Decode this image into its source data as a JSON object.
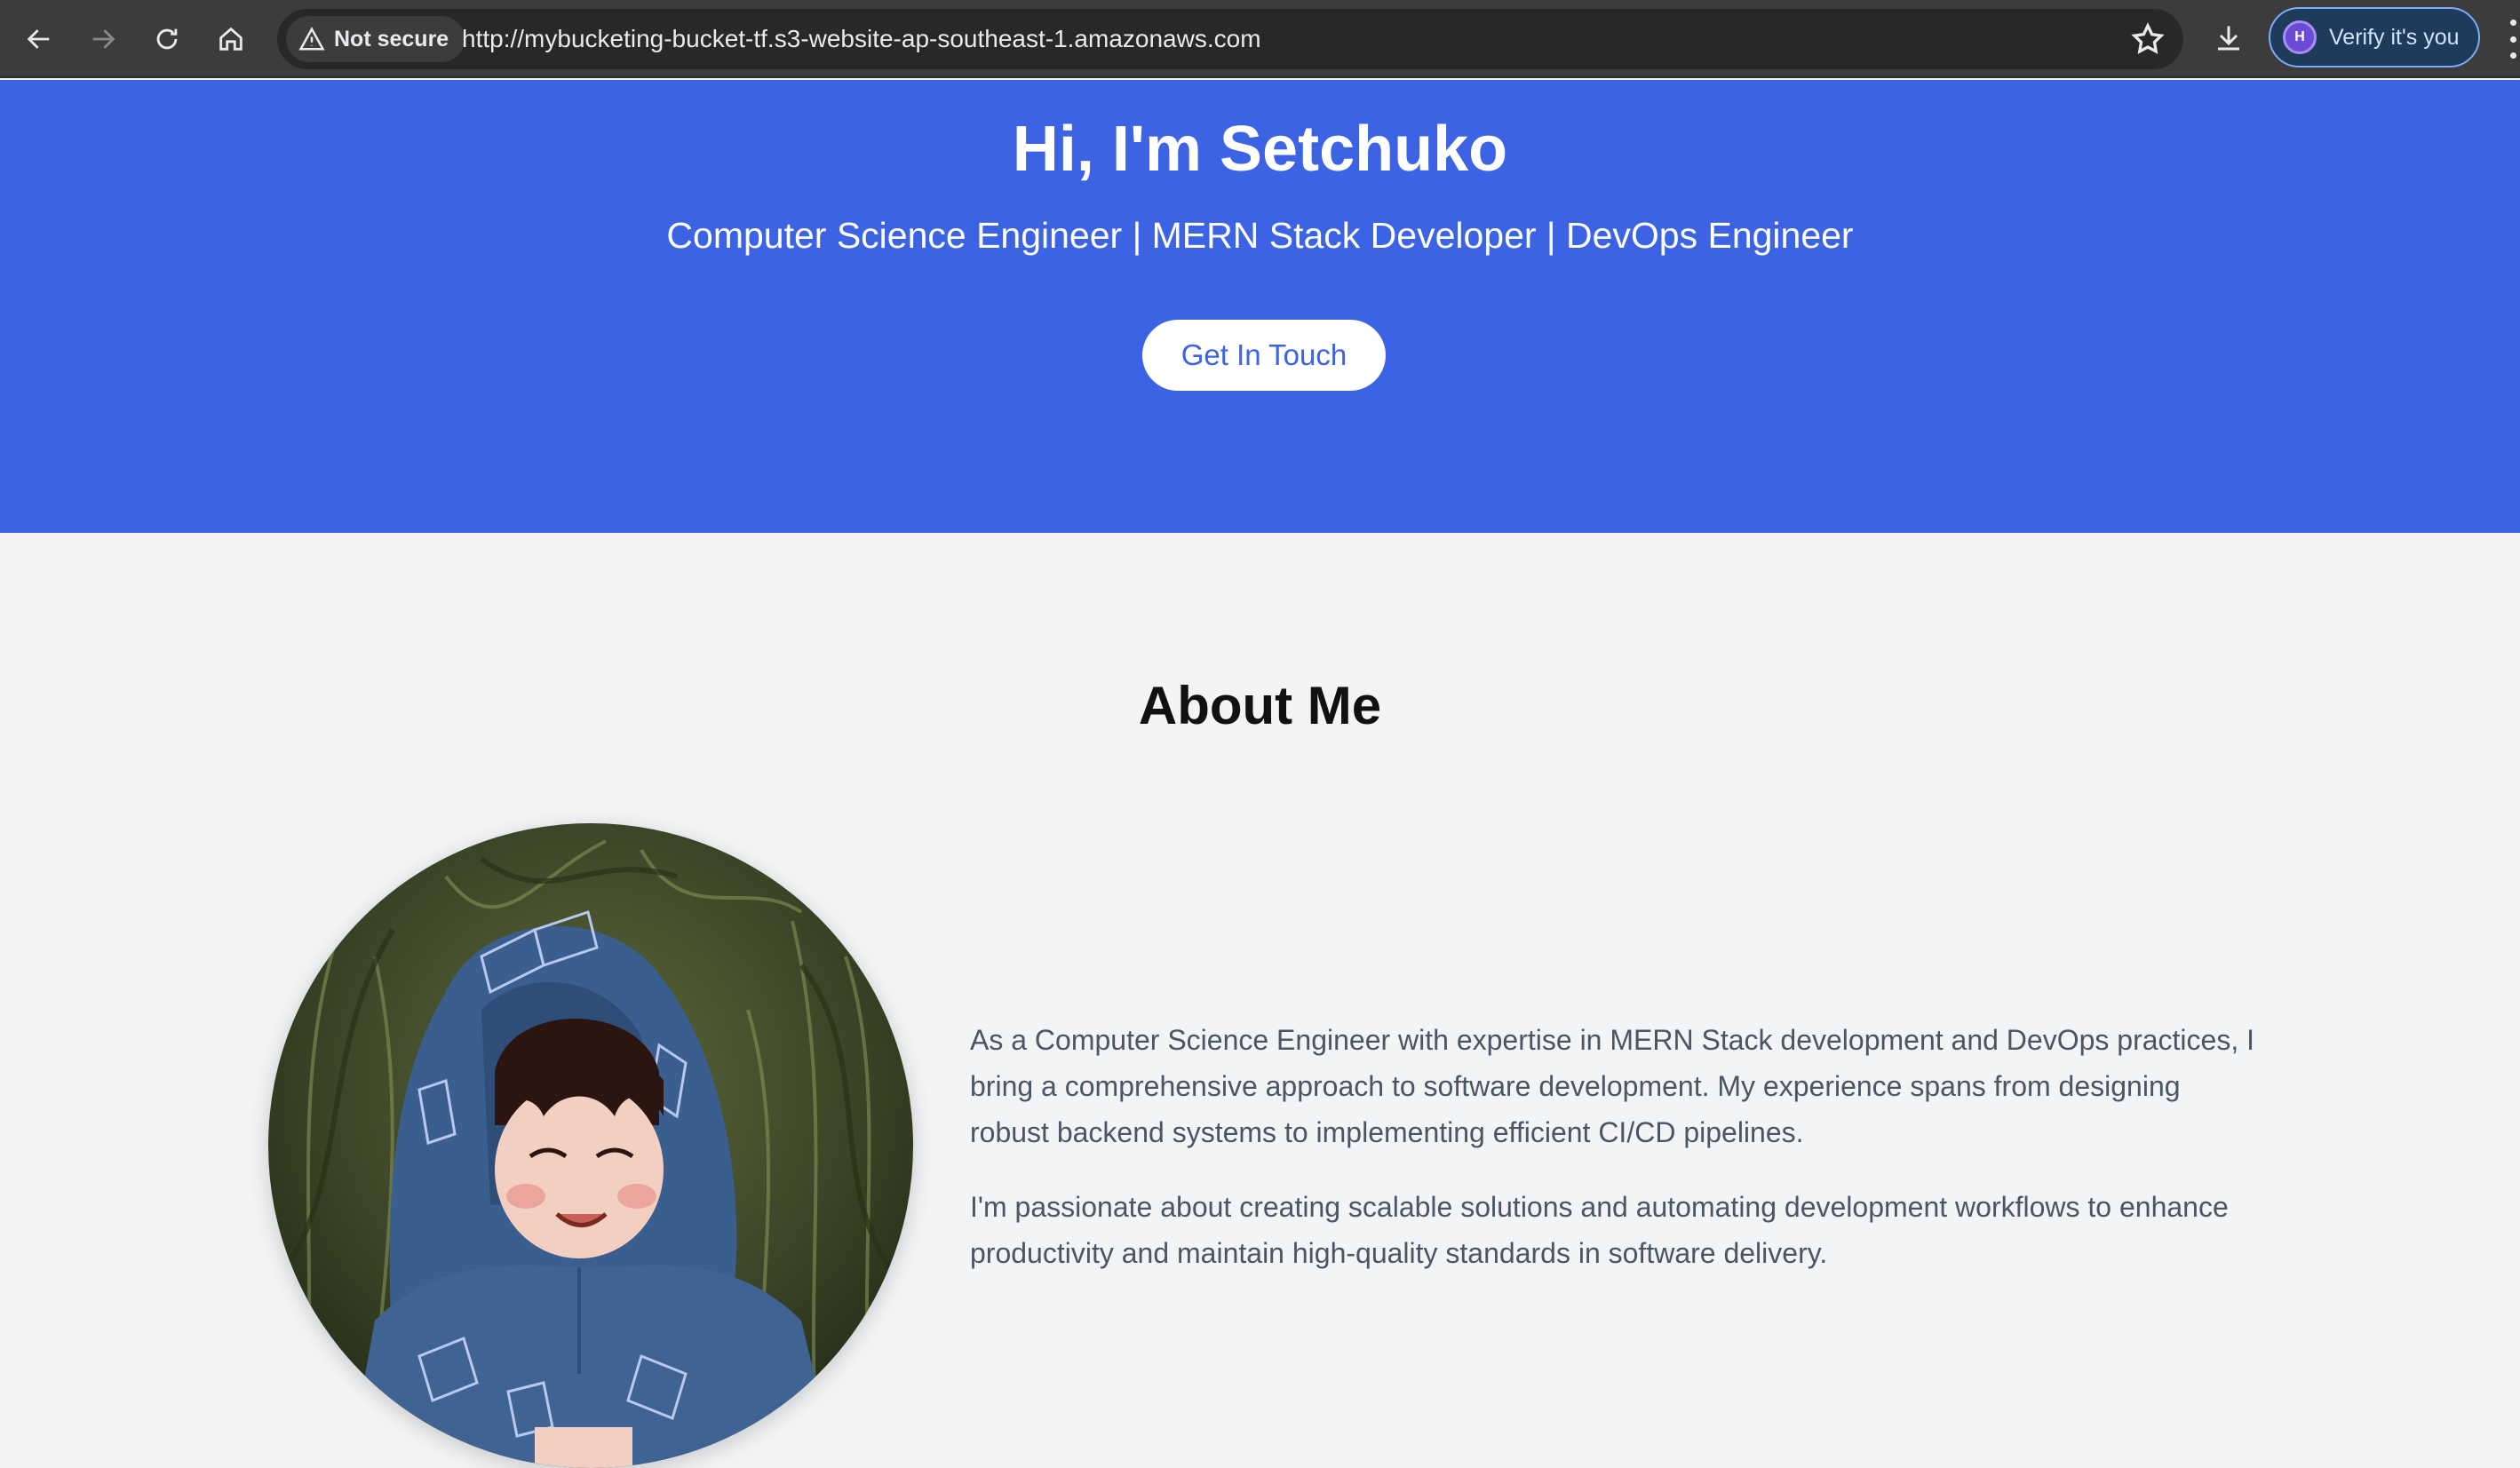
{
  "browser": {
    "security_label": "Not secure",
    "url": "http://mybucketing-bucket-tf.s3-website-ap-southeast-1.amazonaws.com",
    "verify_label": "Verify it's you",
    "profile_initial": "H"
  },
  "hero": {
    "title": "Hi, I'm Setchuko",
    "subtitle": "Computer Science Engineer | MERN Stack Developer | DevOps Engineer",
    "cta_label": "Get In Touch"
  },
  "about": {
    "heading": "About Me",
    "paragraphs": [
      "As a Computer Science Engineer with expertise in MERN Stack development and DevOps practices, I bring a comprehensive approach to software development. My experience spans from designing robust backend systems to implementing efficient CI/CD pipelines.",
      "I'm passionate about creating scalable solutions and automating development workflows to enhance productivity and maintain high-quality standards in software delivery."
    ]
  },
  "colors": {
    "hero_bg": "#3b63e3",
    "page_bg": "#f3f4f6",
    "text_body": "#4b5563"
  }
}
